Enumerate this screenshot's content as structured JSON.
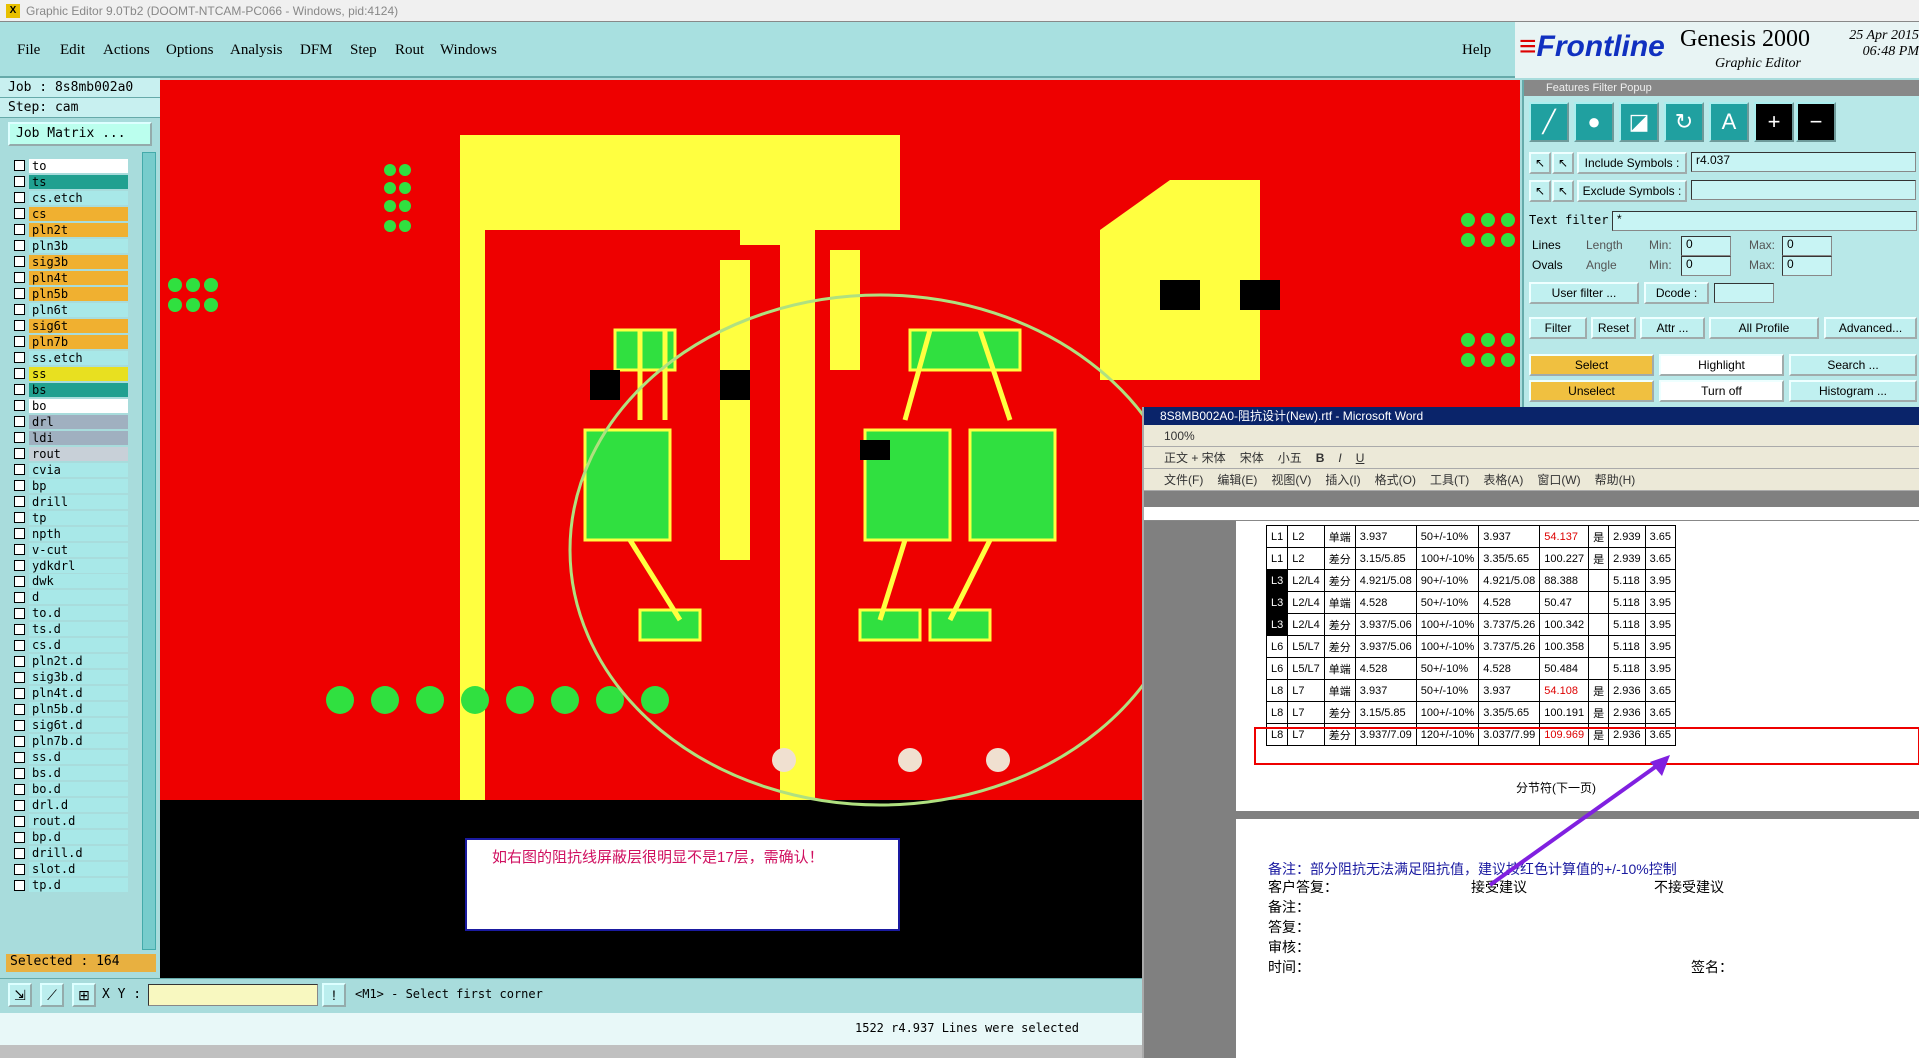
{
  "titlebar": {
    "text": "Graphic Editor 9.0Tb2 (DOOMT-NTCAM-PC066 - Windows, pid:4124)"
  },
  "menu": {
    "file": "File",
    "edit": "Edit",
    "actions": "Actions",
    "options": "Options",
    "analysis": "Analysis",
    "dfm": "DFM",
    "step": "Step",
    "rout": "Rout",
    "windows": "Windows",
    "help": "Help"
  },
  "brand": {
    "logo": "Frontline",
    "product": "Genesis 2000",
    "subtitle": "Graphic Editor",
    "date": "25 Apr 2015",
    "time": "06:48 PM"
  },
  "job": {
    "label": "Job : 8s8mb002a0",
    "step": "Step: cam",
    "matrix": "Job Matrix ..."
  },
  "layers": [
    {
      "name": "to",
      "color": "#ffffff"
    },
    {
      "name": "ts",
      "color": "#20a090"
    },
    {
      "name": "cs.etch",
      "color": "#a8e8e8"
    },
    {
      "name": "cs",
      "color": "#f0b030"
    },
    {
      "name": "pln2t",
      "color": "#f0b030"
    },
    {
      "name": "pln3b",
      "color": "#a8e8e8"
    },
    {
      "name": "sig3b",
      "color": "#f0b030"
    },
    {
      "name": "pln4t",
      "color": "#f0b030"
    },
    {
      "name": "pln5b",
      "color": "#f0b030"
    },
    {
      "name": "pln6t",
      "color": "#a8e8e8"
    },
    {
      "name": "sig6t",
      "color": "#f0b030"
    },
    {
      "name": "pln7b",
      "color": "#f0b030"
    },
    {
      "name": "ss.etch",
      "color": "#a8e8e8"
    },
    {
      "name": "ss",
      "color": "#e8e020"
    },
    {
      "name": "bs",
      "color": "#20a090"
    },
    {
      "name": "bo",
      "color": "#ffffff"
    },
    {
      "name": "drl",
      "color": "#a0b0c0"
    },
    {
      "name": "ldi",
      "color": "#a0b0c0"
    },
    {
      "name": "rout",
      "color": "#c8d0d8"
    },
    {
      "name": "cvia",
      "color": "#a8e8e8"
    },
    {
      "name": "bp",
      "color": "#a8e8e8"
    },
    {
      "name": "drill",
      "color": "#a8e8e8"
    },
    {
      "name": "tp",
      "color": "#a8e8e8"
    },
    {
      "name": "npth",
      "color": "#a8e8e8"
    },
    {
      "name": "v-cut",
      "color": "#a8e8e8"
    },
    {
      "name": "ydkdrl",
      "color": "#a8e8e8"
    },
    {
      "name": "dwk",
      "color": "#a8e8e8"
    },
    {
      "name": "d",
      "color": "#a8e8e8"
    },
    {
      "name": "to.d",
      "color": "#a8e8e8"
    },
    {
      "name": "ts.d",
      "color": "#a8e8e8"
    },
    {
      "name": "cs.d",
      "color": "#a8e8e8"
    },
    {
      "name": "pln2t.d",
      "color": "#a8e8e8"
    },
    {
      "name": "sig3b.d",
      "color": "#a8e8e8"
    },
    {
      "name": "pln4t.d",
      "color": "#a8e8e8"
    },
    {
      "name": "pln5b.d",
      "color": "#a8e8e8"
    },
    {
      "name": "sig6t.d",
      "color": "#a8e8e8"
    },
    {
      "name": "pln7b.d",
      "color": "#a8e8e8"
    },
    {
      "name": "ss.d",
      "color": "#a8e8e8"
    },
    {
      "name": "bs.d",
      "color": "#a8e8e8"
    },
    {
      "name": "bo.d",
      "color": "#a8e8e8"
    },
    {
      "name": "drl.d",
      "color": "#a8e8e8"
    },
    {
      "name": "rout.d",
      "color": "#a8e8e8"
    },
    {
      "name": "bp.d",
      "color": "#a8e8e8"
    },
    {
      "name": "drill.d",
      "color": "#a8e8e8"
    },
    {
      "name": "slot.d",
      "color": "#a8e8e8"
    },
    {
      "name": "tp.d",
      "color": "#a8e8e8"
    }
  ],
  "selected": "Selected : 164",
  "message": "如右图的阻抗线屏蔽层很明显不是17层，需确认！",
  "bottom": {
    "xy_label": "X Y :",
    "prompt": "<M1> - Select first corner",
    "status": "1522 r4.937 Lines were selected"
  },
  "ffp": {
    "title": "Features Filter Popup",
    "include_label": "Include Symbols :",
    "include_value": "r4.037",
    "exclude_label": "Exclude Symbols :",
    "text_filter_label": "Text filter",
    "text_filter_value": "*",
    "lines": "Lines",
    "ovals": "Ovals",
    "length": "Length",
    "angle": "Angle",
    "min": "Min:",
    "max": "Max:",
    "min_val": "0",
    "max_val": "0",
    "user_filter": "User filter ...",
    "dcode": "Dcode :",
    "filter": "Filter",
    "reset": "Reset",
    "attr": "Attr ...",
    "profile": "All Profile",
    "advanced": "Advanced...",
    "select": "Select",
    "highlight": "Highlight",
    "search": "Search ...",
    "unselect": "Unselect",
    "turnoff": "Turn off",
    "histogram": "Histogram ..."
  },
  "word": {
    "title": "8S8MB002A0-阻抗设计(New).rtf - Microsoft Word",
    "style": "正文 + 宋体",
    "font": "宋体",
    "size": "小五",
    "zoom": "100%",
    "menu": [
      "文件(F)",
      "编辑(E)",
      "视图(V)",
      "插入(I)",
      "格式(O)",
      "工具(T)",
      "表格(A)",
      "窗口(W)",
      "帮助(H)"
    ],
    "rows": [
      [
        "L1",
        "L2",
        "单端",
        "3.937",
        "50+/-10%",
        "3.937",
        "54.137",
        "是",
        "2.939",
        "3.65"
      ],
      [
        "L1",
        "L2",
        "差分",
        "3.15/5.85",
        "100+/-10%",
        "3.35/5.65",
        "100.227",
        "是",
        "2.939",
        "3.65"
      ],
      [
        "L3",
        "L2/L4",
        "差分",
        "4.921/5.08",
        "90+/-10%",
        "4.921/5.08",
        "88.388",
        "",
        "5.118",
        "3.95"
      ],
      [
        "L3",
        "L2/L4",
        "单端",
        "4.528",
        "50+/-10%",
        "4.528",
        "50.47",
        "",
        "5.118",
        "3.95"
      ],
      [
        "L3",
        "L2/L4",
        "差分",
        "3.937/5.06",
        "100+/-10%",
        "3.737/5.26",
        "100.342",
        "",
        "5.118",
        "3.95"
      ],
      [
        "L6",
        "L5/L7",
        "差分",
        "3.937/5.06",
        "100+/-10%",
        "3.737/5.26",
        "100.358",
        "",
        "5.118",
        "3.95"
      ],
      [
        "L6",
        "L5/L7",
        "单端",
        "4.528",
        "50+/-10%",
        "4.528",
        "50.484",
        "",
        "5.118",
        "3.95"
      ],
      [
        "L8",
        "L7",
        "单端",
        "3.937",
        "50+/-10%",
        "3.937",
        "54.108",
        "是",
        "2.936",
        "3.65"
      ],
      [
        "L8",
        "L7",
        "差分",
        "3.15/5.85",
        "100+/-10%",
        "3.35/5.65",
        "100.191",
        "是",
        "2.936",
        "3.65"
      ],
      [
        "L8",
        "L7",
        "差分",
        "3.937/7.09",
        "120+/-10%",
        "3.037/7.99",
        "109.969",
        "是",
        "2.936",
        "3.65"
      ]
    ],
    "section_break": "分节符(下一页)",
    "note": "备注：部分阻抗无法满足阻抗值，建议按红色计算值的+/-10%控制",
    "reply": "客户答复：",
    "accept": "接受建议",
    "reject": "不接受建议",
    "remark": "备注：",
    "answer": "答复：",
    "review": "审核：",
    "time": "时间：",
    "sign": "签名："
  }
}
